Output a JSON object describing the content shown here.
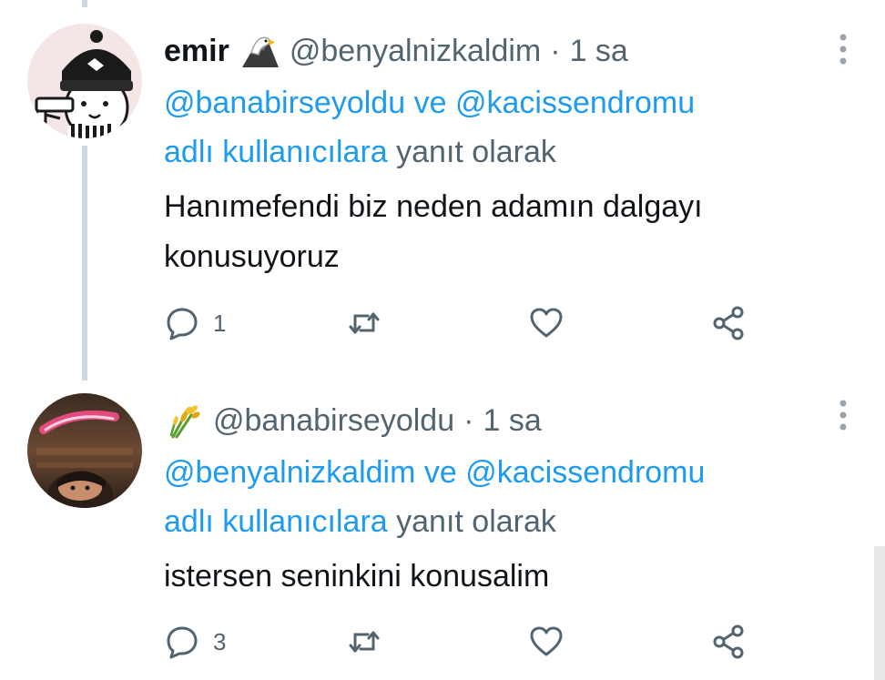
{
  "tweets": [
    {
      "display_name": "emir",
      "name_emoji": "eagle-emoji",
      "handle": "@benyalnizkaldim",
      "separator": "·",
      "time": "1 sa",
      "reply_mention_1": "@banabirseyoldu",
      "reply_and": "ve",
      "reply_mention_2": "@kacissendromu",
      "reply_users": "adlı kullanıcılara",
      "reply_suffix": "yanıt olarak",
      "text_line_1": "Hanımefendi biz neden adamın dalgayı",
      "text_line_2": "konusuyoruz",
      "reply_count": "1",
      "avatar": "cartoon-beanie-avatar"
    },
    {
      "display_name": "",
      "name_emoji": "sheaf-of-rice-emoji",
      "handle": "@banabirseyoldu",
      "separator": "·",
      "time": "1 sa",
      "reply_mention_1": "@benyalnizkaldim",
      "reply_and": "ve",
      "reply_mention_2": "@kacissendromu",
      "reply_users": "adlı kullanıcılara",
      "reply_suffix": "yanıt olarak",
      "text_line_1": "istersen seninkini konusalim",
      "reply_count": "3",
      "avatar": "photo-avatar-neon-sign"
    }
  ],
  "icons": {
    "reply": "reply-bubble-icon",
    "retweet": "retweet-icon",
    "like": "heart-icon",
    "share": "share-icon",
    "more": "more-vertical-icon"
  },
  "colors": {
    "mention": "#1d9bf0",
    "secondary": "#536471",
    "text": "#0f1419",
    "thread_line": "#cfd9de"
  }
}
